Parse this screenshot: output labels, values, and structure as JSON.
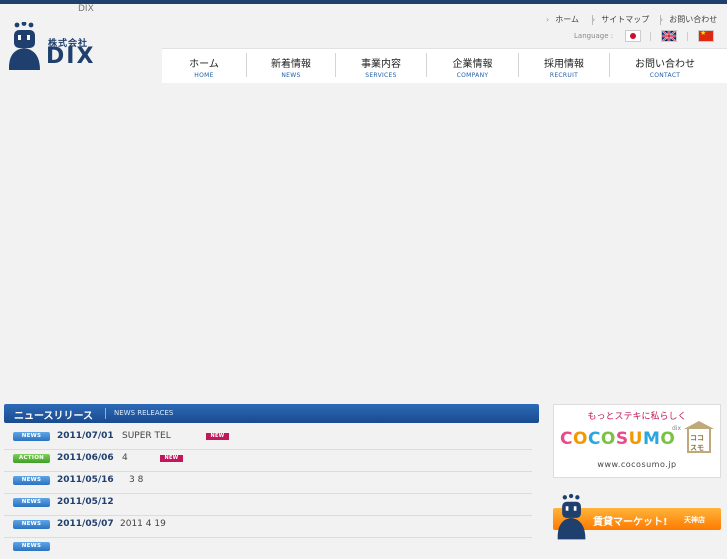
{
  "brand": {
    "tag": "DIX",
    "company_kk": "株式会社",
    "logo_text": "DIX"
  },
  "util_links": [
    "ホーム",
    "サイトマップ",
    "お問い合わせ"
  ],
  "language": {
    "label": "Language :",
    "flags": [
      "japan-flag",
      "uk-flag",
      "china-flag"
    ]
  },
  "nav": [
    {
      "ja": "ホーム",
      "en": "HOME"
    },
    {
      "ja": "新着情報",
      "en": "NEWS"
    },
    {
      "ja": "事業内容",
      "en": "SERVICES"
    },
    {
      "ja": "企業情報",
      "en": "COMPANY"
    },
    {
      "ja": "採用情報",
      "en": "RECRUIT"
    },
    {
      "ja": "お問い合わせ",
      "en": "CONTACT"
    }
  ],
  "news": {
    "title_ja": "ニュースリリース",
    "title_en": "NEWS RELEACES",
    "new_label": "NEW",
    "items": [
      {
        "badge": "NEWS",
        "date": "2011/07/01",
        "title": "SUPER TEL",
        "is_new": true
      },
      {
        "badge": "ACTION",
        "date": "2011/06/06",
        "title": "4",
        "is_new": true
      },
      {
        "badge": "NEWS",
        "date": "2011/05/16",
        "title": "3 8",
        "is_new": false
      },
      {
        "badge": "NEWS",
        "date": "2011/05/12",
        "title": "",
        "is_new": false
      },
      {
        "badge": "NEWS",
        "date": "2011/05/07",
        "title": "2011 4 19",
        "is_new": false
      }
    ]
  },
  "sidebar": {
    "banner1": {
      "tagline": "もっとステキに私らしく",
      "brand": "COCOSUMO",
      "brand_letters": [
        "C",
        "O",
        "C",
        "O",
        "S",
        "U",
        "M",
        "O"
      ],
      "brand_colors": [
        "#e84a8a",
        "#f39800",
        "#2aa7e0",
        "#7cc242",
        "#e84a8a",
        "#f39800",
        "#2aa7e0",
        "#7cc242"
      ],
      "small": "dix",
      "house_text": "ココ\nスモ",
      "url": "www.cocosumo.jp"
    },
    "banner2": {
      "label": "賃貸マーケット!",
      "store": "天神店"
    }
  },
  "colors": {
    "brand_navy": "#1f3f6e",
    "nav_en_blue": "#1f5da8",
    "news_header_blue": "#1a4a8f",
    "new_badge_pink": "#c2185b",
    "action_green": "#3f9d25",
    "banner_orange": "#ff7a00"
  }
}
